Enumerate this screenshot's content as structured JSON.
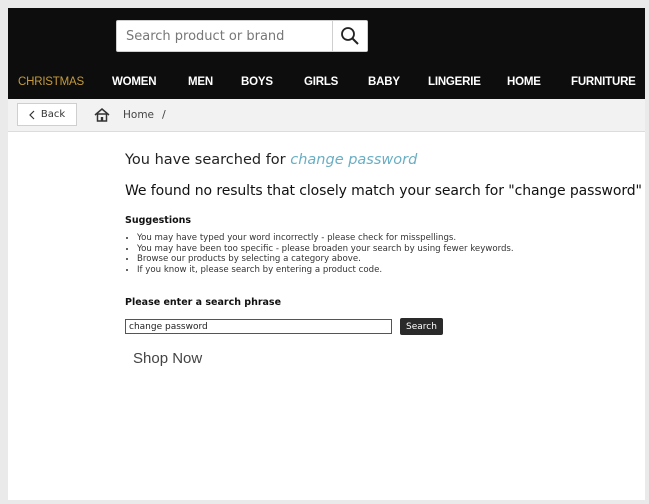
{
  "search": {
    "placeholder": "Search product or brand"
  },
  "nav": {
    "items": [
      {
        "label": "CHRISTMAS"
      },
      {
        "label": "WOMEN"
      },
      {
        "label": "MEN"
      },
      {
        "label": "BOYS"
      },
      {
        "label": "GIRLS"
      },
      {
        "label": "BABY"
      },
      {
        "label": "LINGERIE"
      },
      {
        "label": "HOME"
      },
      {
        "label": "FURNITURE"
      }
    ],
    "active_color": "#c79a3b"
  },
  "breadcrumb": {
    "back_label": "Back",
    "home_label": "Home",
    "separator": "/"
  },
  "results": {
    "searched_prefix": "You have searched for",
    "searched_term": "change password",
    "no_results": "We found no results that closely match your search for \"change password\"",
    "suggestions_title": "Suggestions",
    "suggestions": [
      "You may have typed your word incorrectly - please check for misspellings.",
      "You may have been too specific - please broaden your search by using fewer keywords.",
      "Browse our products by selecting a category above.",
      "If you know it, please search by entering a product code."
    ],
    "phrase_label": "Please enter a search phrase",
    "phrase_value": "change password",
    "search_button": "Search",
    "shop_now": "Shop Now"
  },
  "colors": {
    "header_bg": "#0d0d0d",
    "link": "#6aaec3"
  },
  "icons": [
    "search-icon",
    "chevron-left-icon",
    "home-icon"
  ]
}
